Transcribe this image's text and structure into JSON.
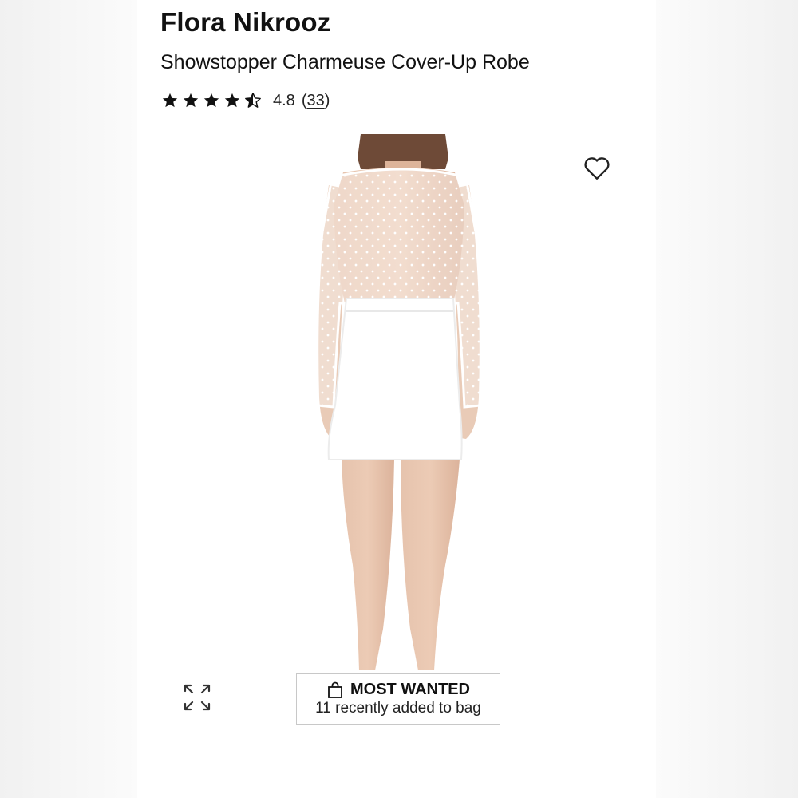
{
  "product": {
    "brand": "Flora Nikrooz",
    "name": "Showstopper Charmeuse Cover-Up Robe",
    "rating": {
      "value": 4.8,
      "value_text": "4.8",
      "review_count": "33",
      "open_paren": "(",
      "close_paren": ")",
      "max_stars": 5
    }
  },
  "gallery": {
    "image_alt": "Model wearing white sheer dotted robe, back view",
    "wishlist_icon": "heart-outline-icon",
    "expand_icon": "expand-arrows-icon",
    "total_images": 7,
    "active_index": 4
  },
  "badge": {
    "icon": "shopping-bag-icon",
    "title": "MOST WANTED",
    "subtitle": "11 recently added to bag"
  },
  "colors": {
    "text": "#111111",
    "dot_inactive": "#c7c7c7",
    "dot_active": "#111111",
    "badge_border": "#c8c8c8"
  }
}
